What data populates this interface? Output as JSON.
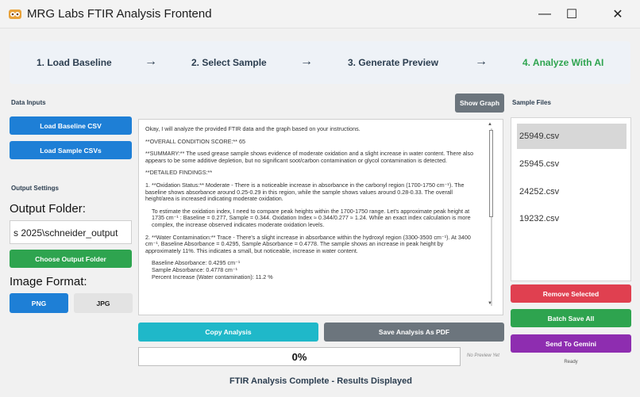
{
  "window": {
    "title": "MRG Labs FTIR Analysis Frontend",
    "minimize": "—",
    "maximize": "☐",
    "close": "✕"
  },
  "steps": [
    {
      "label": "1. Load Baseline"
    },
    {
      "label": "2. Select Sample"
    },
    {
      "label": "3. Generate Preview"
    },
    {
      "label": "4. Analyze With AI"
    }
  ],
  "step_arrow": "→",
  "colors": {
    "accent_blue": "#1e7fd6",
    "accent_green": "#2ea44f",
    "accent_red": "#e04050",
    "accent_purple": "#8e2db0",
    "accent_teal": "#1fb8c9"
  },
  "left": {
    "data_inputs_label": "Data Inputs",
    "load_baseline": "Load Baseline CSV",
    "load_samples": "Load Sample CSVs",
    "output_settings_label": "Output Settings",
    "output_folder_label": "Output Folder:",
    "output_folder_value": "s 2025\\schneider_output",
    "choose_folder": "Choose Output Folder",
    "image_format_label": "Image Format:",
    "format_png": "PNG",
    "format_jpg": "JPG"
  },
  "center": {
    "show_graph": "Show Graph",
    "analysis_paragraphs": [
      "Okay, I will analyze the provided FTIR data and the graph based on your instructions.",
      "**OVERALL CONDITION SCORE:** 65",
      "**SUMMARY:** The used grease sample shows evidence of moderate oxidation and a slight increase in water content. There also appears to be some additive depletion, but no significant soot/carbon contamination or glycol contamination is detected.",
      "**DETAILED FINDINGS:**",
      "1. **Oxidation Status:** Moderate - There is a noticeable increase in absorbance in the carbonyl region (1700-1750 cm⁻¹). The baseline shows absorbance around 0.25-0.29 in this region, while the sample shows values around 0.28-0.33. The overall height/area is increased indicating moderate oxidation.",
      "To estimate the oxidation index, I need to compare peak heights within the 1700-1750 range. Let's approximate peak height at 1735 cm⁻¹ : Baseline = 0.277, Sample = 0.344. Oxidation Index ≈ 0.344/0.277 ≈ 1.24. While an exact index calculation is more complex, the increase observed indicates moderate oxidation levels.",
      "2. **Water Contamination:** Trace - There's a slight increase in absorbance within the hydroxyl region (3300-3500 cm⁻¹). At 3400 cm⁻¹, Baseline Absorbance = 0.4295, Sample Absorbance = 0.4778. The sample shows an increase in peak height by approximately 11%. This indicates a small, but noticeable, increase in water content.",
      "Baseline Absorbance: 0.4295 cm⁻¹",
      "Sample Absorbance: 0.4778 cm⁻¹",
      "Percent Increase (Water contamination): 11.2 %"
    ],
    "scroll_up": "▲",
    "scroll_down": "▼",
    "copy_analysis": "Copy Analysis",
    "save_pdf": "Save Analysis As PDF",
    "progress_text": "0%",
    "progress_value": 0,
    "preview_note": "No Preview Yet",
    "status": "FTIR Analysis Complete - Results Displayed"
  },
  "right": {
    "sample_files_label": "Sample Files",
    "files": [
      "25949.csv",
      "25945.csv",
      "24252.csv",
      "19232.csv"
    ],
    "selected_index": 0,
    "remove_selected": "Remove Selected",
    "batch_save": "Batch Save All",
    "send_gemini": "Send To Gemini",
    "ready": "Ready"
  }
}
